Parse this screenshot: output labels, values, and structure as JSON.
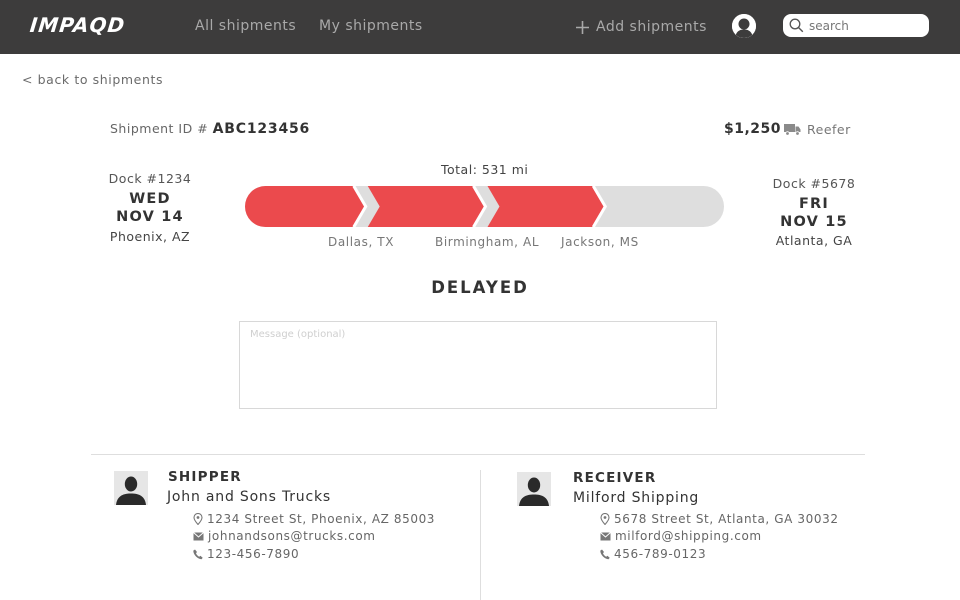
{
  "header": {
    "logo": "IMPAQD",
    "nav": [
      "All shipments",
      "My shipments"
    ],
    "add_label": "Add shipments",
    "search_placeholder": "search"
  },
  "back_link": "< back to shipments",
  "shipment": {
    "id_label": "Shipment ID #",
    "id": "ABC123456",
    "price": "$1,250",
    "equipment": "Reefer",
    "total": "Total: 531 mi",
    "progress_fraction": 0.75,
    "origin": {
      "dock": "Dock #1234",
      "day": "WED",
      "date": "NOV 14",
      "city": "Phoenix, AZ"
    },
    "destination": {
      "dock": "Dock #5678",
      "day": "FRI",
      "date": "NOV 15",
      "city": "Atlanta, GA"
    },
    "stops": [
      "Dallas, TX",
      "Birmingham, AL",
      "Jackson, MS"
    ],
    "status": "DELAYED",
    "message_placeholder": "Message (optional)"
  },
  "shipper": {
    "role": "SHIPPER",
    "name": "John and Sons Trucks",
    "address": "1234 Street St, Phoenix, AZ 85003",
    "email": "johnandsons@trucks.com",
    "phone": "123-456-7890"
  },
  "receiver": {
    "role": "RECEIVER",
    "name": "Milford Shipping",
    "address": "5678 Street St, Atlanta, GA 30032",
    "email": "milford@shipping.com",
    "phone": "456-789-0123"
  },
  "colors": {
    "header_bg": "#3d3c3c",
    "progress_red": "#eb4a4d",
    "progress_gray": "#dedede"
  }
}
